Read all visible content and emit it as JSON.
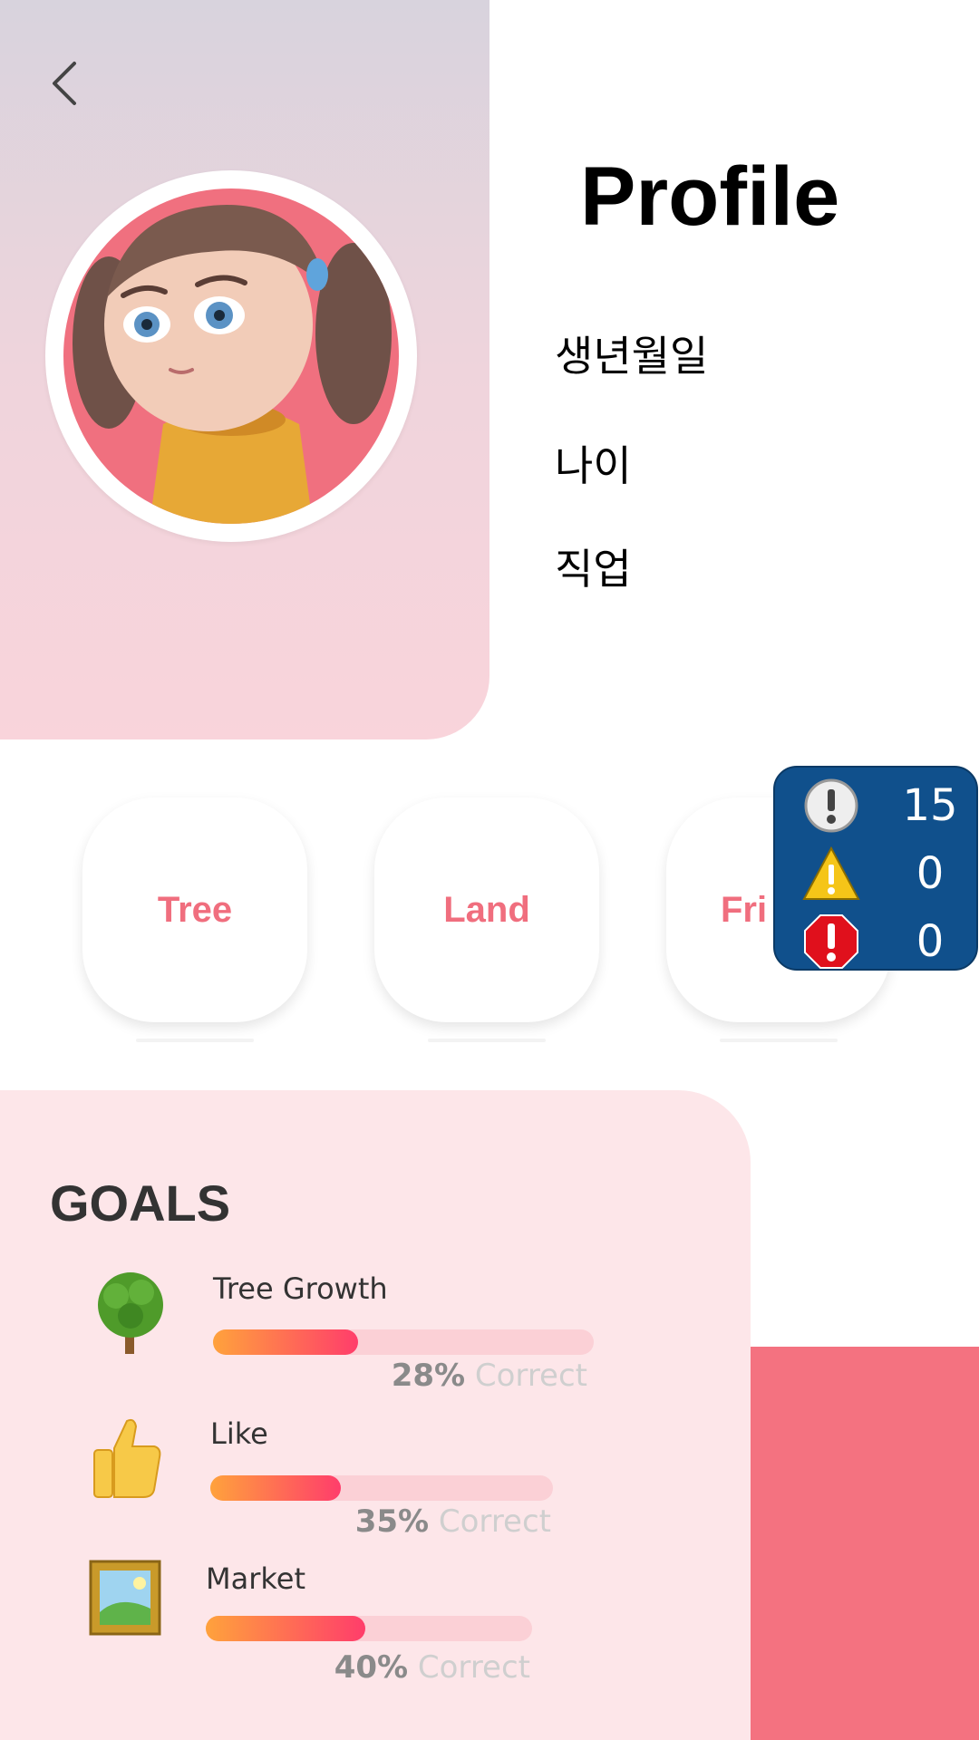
{
  "header": {
    "title": "Profile"
  },
  "profile": {
    "fields": [
      "생년월일",
      "나이",
      "직업"
    ]
  },
  "cards": [
    {
      "label": "Tree"
    },
    {
      "label": "Land"
    },
    {
      "label": "Fri"
    }
  ],
  "status_overlay": {
    "info_count": "15",
    "warning_count": "0",
    "error_count": "0",
    "icons": [
      "info-icon",
      "warning-icon",
      "error-icon"
    ]
  },
  "goals": {
    "title": "GOALS",
    "items": [
      {
        "label": "Tree Growth",
        "percent_text": "28%",
        "suffix": "Correct",
        "progress": 0.38,
        "icon": "tree-icon"
      },
      {
        "label": "Like",
        "percent_text": "35%",
        "suffix": "Correct",
        "progress": 0.38,
        "icon": "thumbs-up-icon"
      },
      {
        "label": "Market",
        "percent_text": "40%",
        "suffix": "Correct",
        "progress": 0.49,
        "icon": "picture-frame-icon"
      }
    ]
  },
  "colors": {
    "accent": "#f06e7e",
    "overlay_bg": "#10508c",
    "goals_bg": "#fde6e9",
    "progress_start": "#ffa23c",
    "progress_end": "#ff3d6b"
  }
}
